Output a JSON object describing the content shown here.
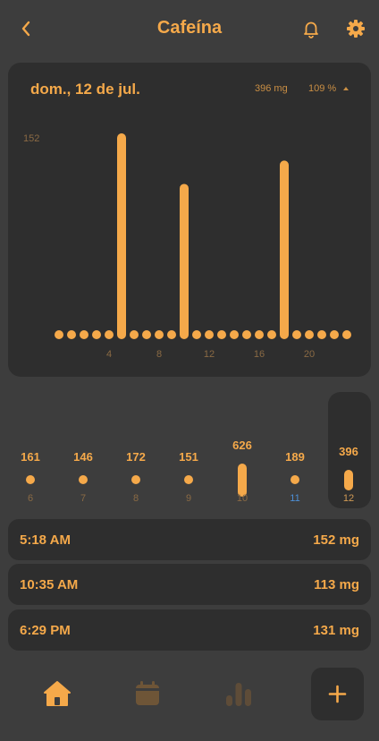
{
  "header": {
    "title": "Cafeína"
  },
  "day": {
    "date": "dom., 12 de jul.",
    "total": "396 mg",
    "percent": "109 %"
  },
  "chart_data": {
    "type": "bar",
    "x": [
      0,
      1,
      2,
      3,
      4,
      5,
      6,
      7,
      8,
      9,
      10,
      11,
      12,
      13,
      14,
      15,
      16,
      17,
      18,
      19,
      20,
      21,
      22,
      23
    ],
    "values": [
      0,
      0,
      0,
      0,
      0,
      152,
      0,
      0,
      0,
      0,
      113,
      0,
      0,
      0,
      0,
      0,
      0,
      0,
      131,
      0,
      0,
      0,
      0,
      0
    ],
    "xticks": [
      "4",
      "8",
      "12",
      "16",
      "20"
    ],
    "ymax_label": "152",
    "ylim": [
      0,
      152
    ]
  },
  "week": [
    {
      "value": "161",
      "day": "6",
      "mg": 161
    },
    {
      "value": "146",
      "day": "7",
      "mg": 146
    },
    {
      "value": "172",
      "day": "8",
      "mg": 172
    },
    {
      "value": "151",
      "day": "9",
      "mg": 151
    },
    {
      "value": "626",
      "day": "10",
      "mg": 626
    },
    {
      "value": "189",
      "day": "11",
      "mg": 189
    },
    {
      "value": "396",
      "day": "12",
      "mg": 396
    }
  ],
  "entries": [
    {
      "time": "5:18 AM",
      "amount": "152 mg"
    },
    {
      "time": "10:35 AM",
      "amount": "113 mg"
    },
    {
      "time": "6:29 PM",
      "amount": "131 mg"
    }
  ],
  "colors": {
    "accent": "#f5a94a",
    "card": "#2e2e2e",
    "background": "#3d3d3d",
    "today": "#4d8fd6"
  },
  "nav": {
    "home_icon": "home-icon",
    "calendar_icon": "calendar-icon",
    "stats_icon": "bar-chart-icon",
    "add_icon": "plus-icon"
  }
}
